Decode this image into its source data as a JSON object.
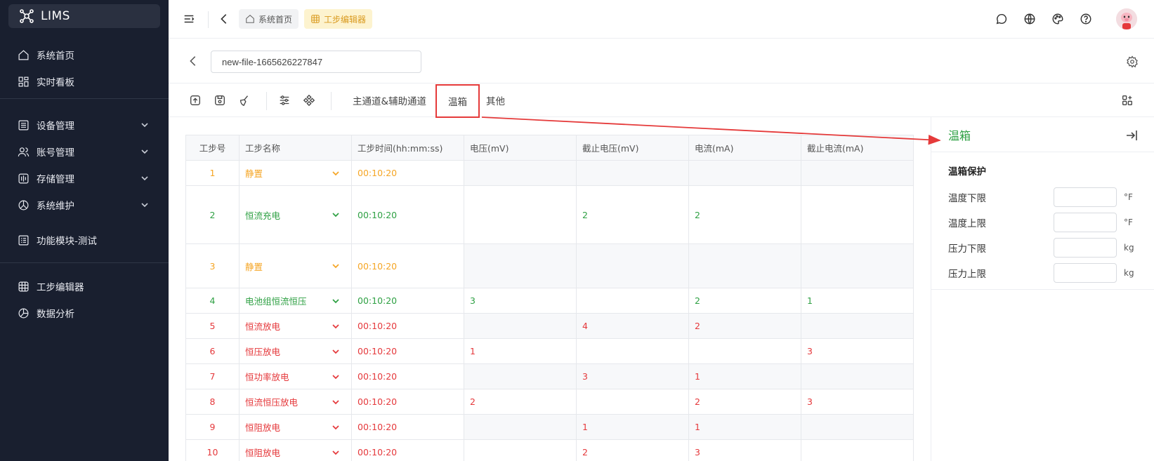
{
  "app": {
    "name": "LIMS"
  },
  "sidebar": {
    "items": [
      {
        "label": "系统首页",
        "icon": "home-icon"
      },
      {
        "label": "实时看板",
        "icon": "dashboard-icon"
      },
      {
        "label": "设备管理",
        "icon": "device-list-icon"
      },
      {
        "label": "账号管理",
        "icon": "users-icon"
      },
      {
        "label": "存储管理",
        "icon": "storage-icon"
      },
      {
        "label": "系统维护",
        "icon": "maintenance-icon"
      },
      {
        "label": "功能模块-测试",
        "icon": "module-icon"
      },
      {
        "label": "工步编辑器",
        "icon": "grid-icon"
      },
      {
        "label": "数据分析",
        "icon": "pie-icon"
      }
    ]
  },
  "header": {
    "breadcrumbs": [
      {
        "label": "系统首页",
        "icon": "home-icon"
      },
      {
        "label": "工步编辑器",
        "icon": "grid-icon"
      }
    ]
  },
  "file": {
    "name": "new-file-1665626227847"
  },
  "toolbar": {
    "tabs": [
      "主通道&辅助通道",
      "温箱",
      "其他"
    ],
    "active_tab": "温箱"
  },
  "table": {
    "columns": [
      "工步号",
      "工步名称",
      "工步时间(hh:mm:ss)",
      "电压(mV)",
      "截止电压(mV)",
      "电流(mA)",
      "截止电流(mA)"
    ],
    "rows": [
      {
        "no": "1",
        "name": "静置",
        "time": "00:10:20",
        "v": "",
        "cv": "",
        "i": "",
        "ci": "",
        "color": "#f5a524"
      },
      {
        "no": "2",
        "name": "恒流充电",
        "time": "00:10:20",
        "v": "",
        "cv": "2",
        "i": "2",
        "ci": "",
        "color": "#2ea043"
      },
      {
        "no": "3",
        "name": "静置",
        "time": "00:10:20",
        "v": "",
        "cv": "",
        "i": "",
        "ci": "",
        "color": "#f5a524"
      },
      {
        "no": "4",
        "name": "电池组恒流恒压",
        "time": "00:10:20",
        "v": "3",
        "cv": "",
        "i": "2",
        "ci": "1",
        "color": "#2ea043"
      },
      {
        "no": "5",
        "name": "恒流放电",
        "time": "00:10:20",
        "v": "",
        "cv": "4",
        "i": "2",
        "ci": "",
        "color": "#e5383b"
      },
      {
        "no": "6",
        "name": "恒压放电",
        "time": "00:10:20",
        "v": "1",
        "cv": "",
        "i": "",
        "ci": "3",
        "color": "#e5383b"
      },
      {
        "no": "7",
        "name": "恒功率放电",
        "time": "00:10:20",
        "v": "",
        "cv": "3",
        "i": "1",
        "ci": "",
        "color": "#e5383b"
      },
      {
        "no": "8",
        "name": "恒流恒压放电",
        "time": "00:10:20",
        "v": "2",
        "cv": "",
        "i": "2",
        "ci": "3",
        "color": "#e5383b"
      },
      {
        "no": "9",
        "name": "恒阻放电",
        "time": "00:10:20",
        "v": "",
        "cv": "1",
        "i": "1",
        "ci": "",
        "color": "#e5383b"
      },
      {
        "no": "10",
        "name": "恒阻放电",
        "time": "00:10:20",
        "v": "",
        "cv": "2",
        "i": "3",
        "ci": "",
        "color": "#e5383b"
      }
    ]
  },
  "panel": {
    "title": "温箱",
    "section": "温箱保护",
    "fields": [
      {
        "label": "温度下限",
        "value": "",
        "unit": "°F"
      },
      {
        "label": "温度上限",
        "value": "",
        "unit": "°F"
      },
      {
        "label": "压力下限",
        "value": "",
        "unit": "kg"
      },
      {
        "label": "压力上限",
        "value": "",
        "unit": "kg"
      }
    ]
  },
  "colors": {
    "sidebar_bg": "#191f2f",
    "accent_green": "#2ea043",
    "accent_orange": "#f5a524",
    "accent_red": "#e5383b",
    "annotation_red": "#e53a3a"
  }
}
